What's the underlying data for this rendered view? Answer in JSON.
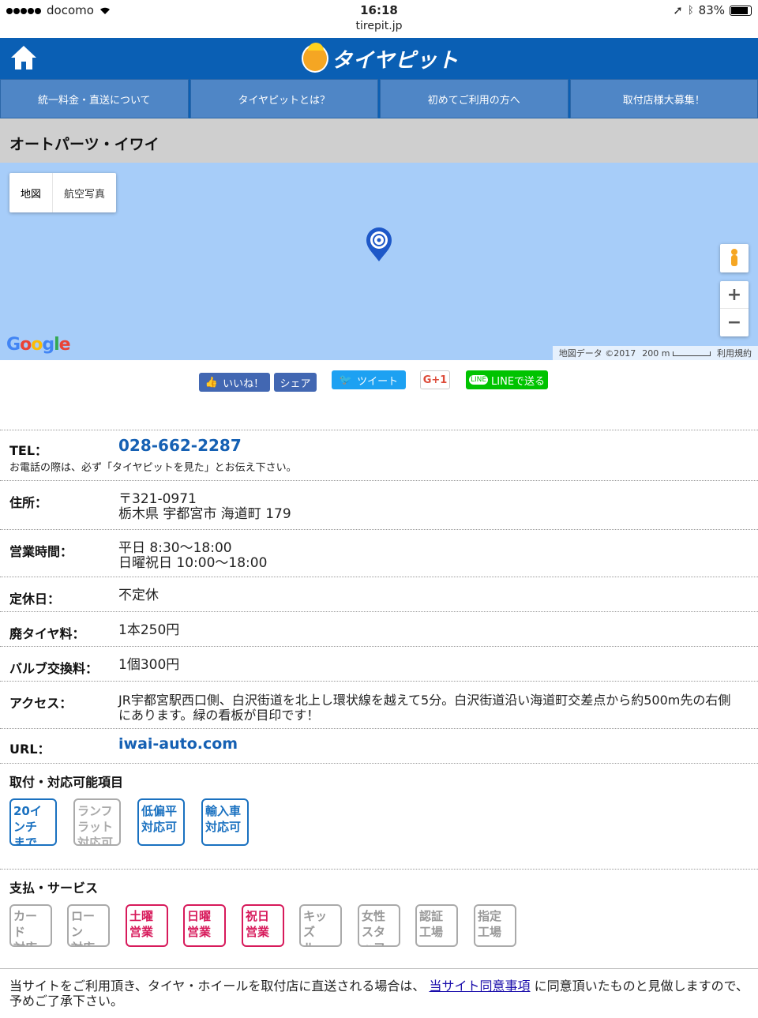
{
  "status_bar": {
    "carrier": "docomo",
    "time": "16:18",
    "url": "tirepit.jp",
    "battery": "83%"
  },
  "header": {
    "logo_text": "タイヤピット"
  },
  "nav": {
    "items": [
      "統一料金・直送について",
      "タイヤピットとは？",
      "初めてご利用の方へ",
      "取付店様大募集！"
    ]
  },
  "page": {
    "title": "オートパーツ・イワイ"
  },
  "map": {
    "type_map": "地図",
    "type_aerial": "航空写真",
    "google": "Google",
    "data_credit": "地図データ ©2017",
    "scale": "200 m",
    "terms": "利用規約",
    "zoom_in": "+",
    "zoom_out": "−"
  },
  "share": {
    "like": "いいね！",
    "share": "シェア",
    "tweet": "ツイート",
    "gplus": "G+1",
    "line": "LINEで送る"
  },
  "info": {
    "tel_label": "TEL：",
    "tel": "028-662-2287",
    "tel_note": "お電話の際は、必ず「タイヤピットを見た」とお伝え下さい。",
    "addr_label": "住所：",
    "addr_zip": "〒321-0971",
    "addr": "栃木県 宇都宮市 海道町 179",
    "hours_label": "営業時間：",
    "hours1": "平日 8:30〜18:00",
    "hours2": "日曜祝日 10:00〜18:00",
    "closed_label": "定休日：",
    "closed": "不定休",
    "tire_label": "廃タイヤ料：",
    "tire": "1本250円",
    "valve_label": "バルブ交換料：",
    "valve": "1個300円",
    "access_label": "アクセス：",
    "access": "JR宇都宮駅西口側、白沢街道を北上し環状線を越えて5分。白沢街道沿い海道町交差点から約500m先の右側にあります。緑の看板が目印です！",
    "url_label": "URL：",
    "url": "iwai-auto.com"
  },
  "capabilities": {
    "title": "取付・対応可能項目",
    "badges": [
      {
        "l1": "20インチ",
        "l2": "までOK",
        "state": "on"
      },
      {
        "l1": "ランフラット",
        "l2": "対応可",
        "state": "off"
      },
      {
        "l1": "低偏平",
        "l2": "対応可",
        "state": "on"
      },
      {
        "l1": "輸入車",
        "l2": "対応可",
        "state": "on"
      }
    ]
  },
  "services": {
    "title": "支払・サービス",
    "badges": [
      {
        "l1": "カード",
        "l2": "対応",
        "state": "off"
      },
      {
        "l1": "ローン",
        "l2": "対応",
        "state": "off"
      },
      {
        "l1": "土曜",
        "l2": "営業",
        "state": "on"
      },
      {
        "l1": "日曜",
        "l2": "営業",
        "state": "on"
      },
      {
        "l1": "祝日",
        "l2": "営業",
        "state": "on"
      },
      {
        "l1": "キッズ",
        "l2": "ルーム",
        "state": "off"
      },
      {
        "l1": "女性",
        "l2": "スタッフ",
        "state": "off"
      },
      {
        "l1": "認証",
        "l2": "工場",
        "state": "off"
      },
      {
        "l1": "指定",
        "l2": "工場",
        "state": "off"
      }
    ]
  },
  "footer": {
    "text1": "当サイトをご利用頂き、タイヤ・ホイールを取付店に直送される場合は、",
    "link": "当サイト同意事項",
    "text2": "に同意頂いたものと見做しますので、予めご了承下さい。"
  },
  "colors": {
    "brand_blue": "#0a5fb4",
    "nav_blue": "#4f86c6",
    "map_water": "#a7cdf9",
    "link": "#1560b3",
    "badge_blue": "#1a71c0",
    "badge_red": "#d71a5b"
  }
}
